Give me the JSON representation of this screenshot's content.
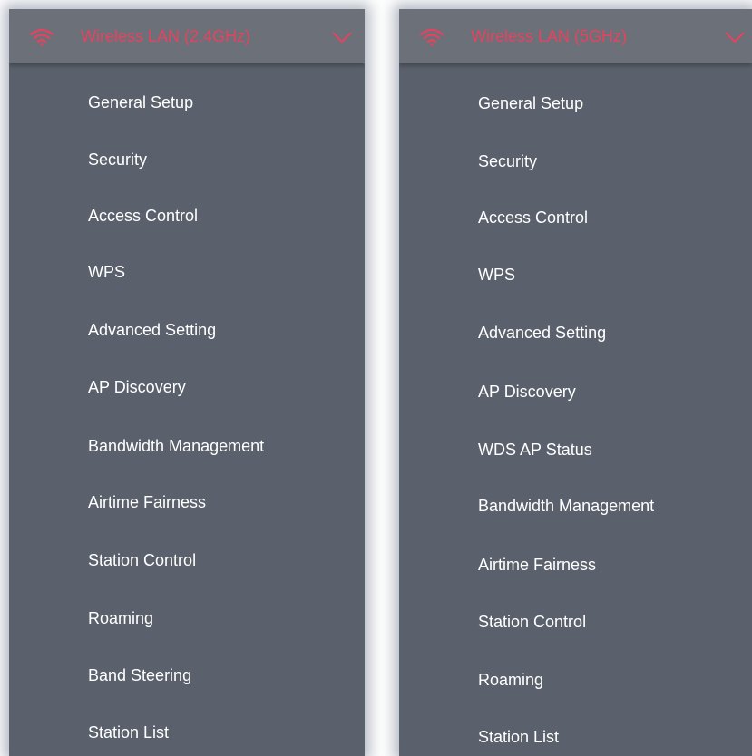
{
  "panels": [
    {
      "title": "Wireless LAN (2.4GHz)",
      "items": [
        "General Setup",
        "Security",
        "Access Control",
        "WPS",
        "Advanced Setting",
        "AP Discovery",
        "Bandwidth Management",
        "Airtime Fairness",
        "Station Control",
        "Roaming",
        "Band Steering",
        "Station List"
      ]
    },
    {
      "title": "Wireless LAN (5GHz)",
      "items": [
        "General Setup",
        "Security",
        "Access Control",
        "WPS",
        "Advanced Setting",
        "AP Discovery",
        "WDS AP Status",
        "Bandwidth Management",
        "Airtime Fairness",
        "Station Control",
        "Roaming",
        "Station List"
      ]
    }
  ],
  "icons": {
    "header_icon": "wifi-icon",
    "expand_icon": "chevron-down-icon"
  },
  "colors": {
    "panel_bg": "#5b616c",
    "header_bg": "#6b7079",
    "title_accent": "#e8425e",
    "item_text": "#ffffff"
  }
}
